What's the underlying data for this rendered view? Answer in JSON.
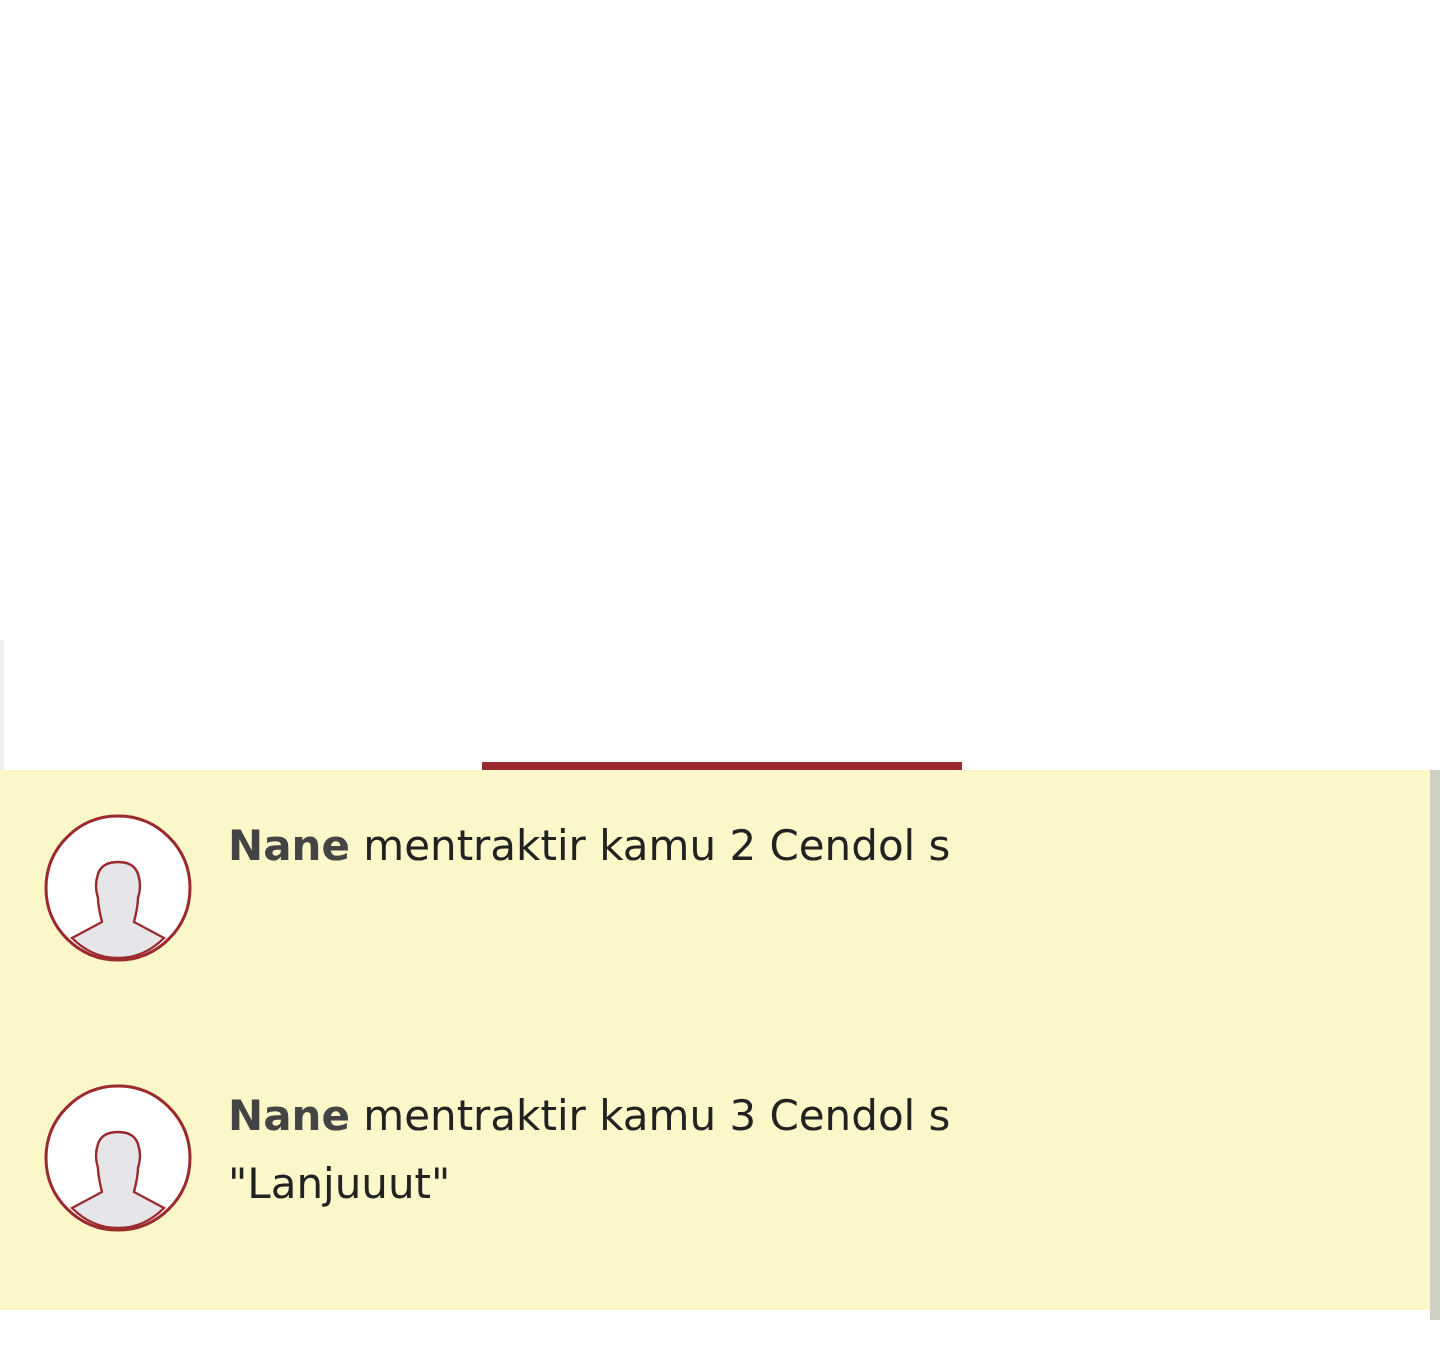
{
  "tabs": [
    {
      "selected": false
    },
    {
      "selected": true
    },
    {
      "selected": false
    }
  ],
  "notifications": [
    {
      "name": "Nane",
      "text": "mentraktir kamu 2 Cendol s",
      "unread": true
    },
    {
      "name": "Nane",
      "text": "mentraktir kamu 3 Cendol s",
      "message": "\"Lanjuuut\"",
      "unread": true
    }
  ]
}
